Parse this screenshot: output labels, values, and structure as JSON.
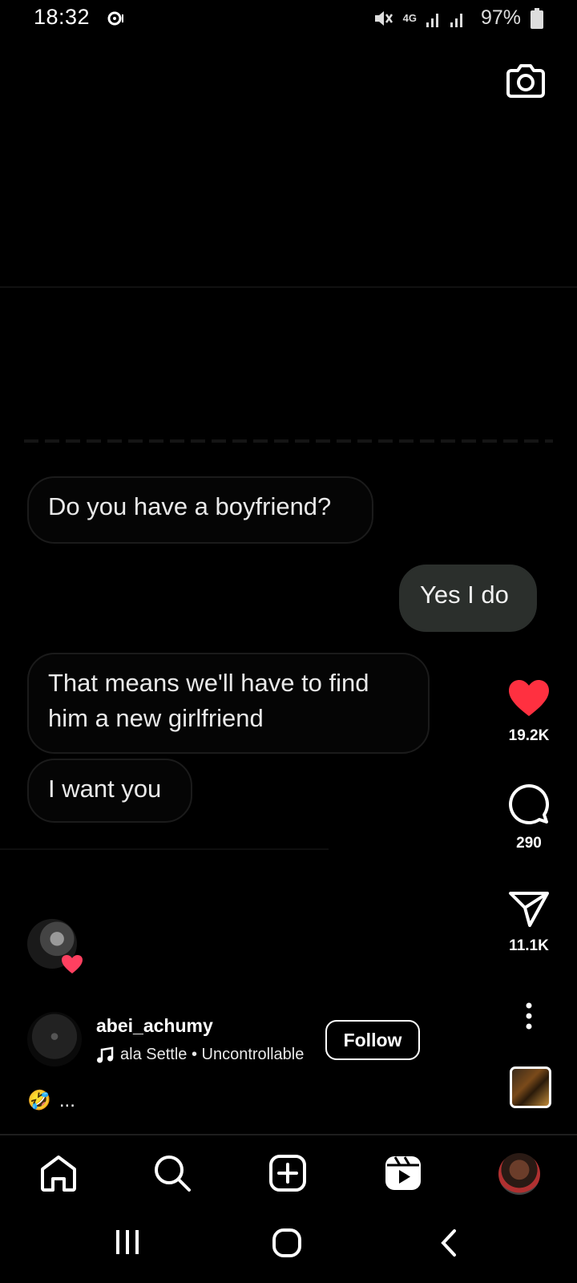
{
  "status_bar": {
    "time": "18:32",
    "network": "4G",
    "battery": "97%"
  },
  "video": {
    "messages": [
      {
        "text": "Do you have a boyfriend?",
        "side": "left"
      },
      {
        "text": "Yes I do",
        "side": "right"
      },
      {
        "text": "That means we'll have to find him a new girlfriend",
        "side": "left"
      },
      {
        "text": "I want you",
        "side": "left"
      }
    ]
  },
  "actions": {
    "likes": "19.2K",
    "comments": "290",
    "shares": "11.1K"
  },
  "post": {
    "author": "abei_achumy",
    "audio": "ala Settle • Uncontrollable",
    "follow_label": "Follow",
    "caption": "..."
  },
  "colors": {
    "like_red": "#ff3040",
    "background": "#000000",
    "outgoing_bubble": "#2b2f2c"
  },
  "icons": {
    "camera": "camera-icon",
    "like": "heart-icon",
    "comment": "comment-icon",
    "share": "send-icon",
    "more": "more-vertical-icon",
    "nav": [
      "home-icon",
      "search-icon",
      "create-icon",
      "reels-icon",
      "profile-avatar"
    ]
  }
}
